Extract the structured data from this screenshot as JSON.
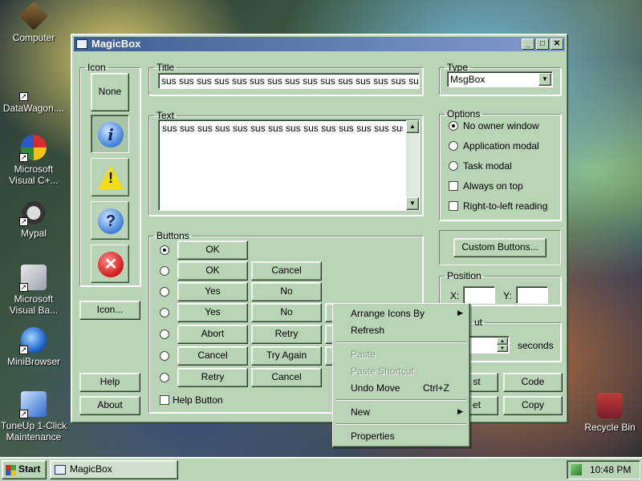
{
  "desktop": {
    "icons": [
      {
        "label": "Computer",
        "icon": "computer-icon"
      },
      {
        "label": "DataWagon....",
        "icon": "shortcut-icon"
      },
      {
        "label": "Microsoft Visual C+...",
        "icon": "visual-cpp-icon"
      },
      {
        "label": "Mypal",
        "icon": "mypal-icon"
      },
      {
        "label": "Microsoft Visual Ba...",
        "icon": "visual-basic-icon"
      },
      {
        "label": "MiniBrowser",
        "icon": "minibrowser-icon"
      },
      {
        "label": "TuneUp 1-Click Maintenance",
        "icon": "tuneup-icon"
      },
      {
        "label": "Recycle Bin",
        "icon": "recycle-bin-icon"
      }
    ]
  },
  "window": {
    "title": "MagicBox",
    "controls": {
      "minimize": "_",
      "maximize": "□",
      "close": "✕"
    }
  },
  "icon_group": {
    "legend": "Icon",
    "none_label": "None",
    "icon_button_label": "Icon...",
    "help_label": "Help",
    "about_label": "About",
    "icons": [
      "info-icon",
      "warning-icon",
      "question-icon",
      "error-icon"
    ]
  },
  "title_group": {
    "legend": "Title",
    "value": "sus sus sus sus sus sus sus sus sus sus sus sus sus sus sus sus"
  },
  "text_group": {
    "legend": "Text",
    "value": "sus sus sus sus sus sus sus sus sus sus sus sus sus sus sus"
  },
  "type_group": {
    "legend": "Type",
    "selected": "MsgBox"
  },
  "options_group": {
    "legend": "Options",
    "no_owner": "No owner window",
    "app_modal": "Application modal",
    "task_modal": "Task modal",
    "always_on_top": "Always on top",
    "rtl_reading": "Right-to-left reading",
    "selected": "No owner window"
  },
  "buttons_group": {
    "legend": "Buttons",
    "rows": [
      {
        "b1": "OK",
        "b2": ""
      },
      {
        "b1": "OK",
        "b2": "Cancel"
      },
      {
        "b1": "Yes",
        "b2": "No"
      },
      {
        "b1": "Yes",
        "b2": "No"
      },
      {
        "b1": "Abort",
        "b2": "Retry"
      },
      {
        "b1": "Cancel",
        "b2": "Try Again"
      },
      {
        "b1": "Retry",
        "b2": "Cancel"
      }
    ],
    "help_button": "Help Button",
    "selected_row": 0
  },
  "custom_buttons_label": "Custom Buttons...",
  "position_group": {
    "legend": "Position",
    "x_label": "X:",
    "y_label": "Y:",
    "x_value": "",
    "y_value": ""
  },
  "timeout_group": {
    "legend_partial": "ut",
    "seconds_label": "seconds"
  },
  "bottom_buttons": {
    "test_partial": "st",
    "reset_partial": "et",
    "code": "Code",
    "copy": "Copy"
  },
  "context_menu": {
    "arrange": "Arrange Icons By",
    "refresh": "Refresh",
    "paste": "Paste",
    "paste_shortcut": "Paste Shortcut",
    "undo_move": "Undo Move",
    "undo_shortcut": "Ctrl+Z",
    "new": "New",
    "properties": "Properties"
  },
  "taskbar": {
    "start": "Start",
    "task_item": "MagicBox",
    "clock": "10:48 PM"
  }
}
